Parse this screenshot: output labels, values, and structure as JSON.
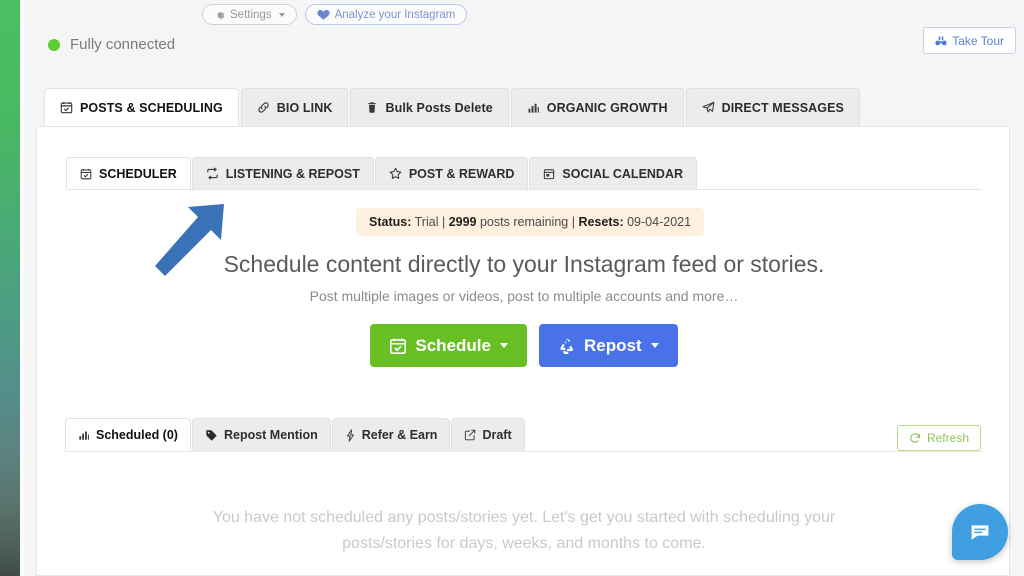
{
  "topbar": {
    "settings_label": "Settings",
    "settings_icon": "gear-icon",
    "analyze_label": "Analyze your Instagram",
    "analyze_icon": "heart-badge-icon",
    "connection_status": "Fully connected",
    "connection_dot_color": "#5ccc33",
    "take_tour_label": "Take Tour",
    "take_tour_icon": "binoculars-icon"
  },
  "main_tabs": [
    {
      "label": "POSTS & SCHEDULING",
      "icon": "calendar-check-icon",
      "active": true
    },
    {
      "label": "BIO LINK",
      "icon": "link-icon",
      "active": false
    },
    {
      "label": "Bulk Posts Delete",
      "icon": "trash-icon",
      "active": false
    },
    {
      "label": "ORGANIC GROWTH",
      "icon": "bar-chart-icon",
      "active": false
    },
    {
      "label": "DIRECT MESSAGES",
      "icon": "paper-plane-icon",
      "active": false
    }
  ],
  "sub_tabs": [
    {
      "label": "SCHEDULER",
      "icon": "calendar-check-icon",
      "active": true
    },
    {
      "label": "LISTENING & REPOST",
      "icon": "repeat-icon",
      "active": false
    },
    {
      "label": "POST & REWARD",
      "icon": "star-icon",
      "active": false
    },
    {
      "label": "SOCIAL CALENDAR",
      "icon": "calendar-icon",
      "active": false
    }
  ],
  "status_banner": {
    "status_label": "Status:",
    "status_value": "Trial",
    "sep1": "|",
    "posts_count": "2999",
    "posts_text": "posts remaining",
    "sep2": "|",
    "resets_label": "Resets:",
    "resets_value": "09-04-2021",
    "background": "#fdf0df"
  },
  "hero": {
    "title": "Schedule content directly to your Instagram feed or stories.",
    "subtitle": "Post multiple images or videos, post to multiple accounts and more…",
    "schedule_button": {
      "label": "Schedule",
      "icon": "calendar-check-icon",
      "color": "#68c025"
    },
    "repost_button": {
      "label": "Repost",
      "icon": "recycle-icon",
      "color": "#4a72e8"
    }
  },
  "lower_tabs": [
    {
      "label": "Scheduled (0)",
      "icon": "bar-chart-icon",
      "active": true
    },
    {
      "label": "Repost Mention",
      "icon": "tag-icon",
      "active": false
    },
    {
      "label": "Refer & Earn",
      "icon": "bolt-icon",
      "active": false
    },
    {
      "label": "Draft",
      "icon": "edit-square-icon",
      "active": false
    }
  ],
  "refresh_button": {
    "label": "Refresh",
    "icon": "refresh-icon",
    "color": "#91c45b"
  },
  "empty_state": {
    "line1": "You have not scheduled any posts/stories yet. Let's get you started with scheduling your",
    "line2": "posts/stories for days, weeks, and months to come."
  },
  "annotation": {
    "arrow": "blue-arrow-up-right",
    "color": "#3a72b8"
  },
  "chat_widget": {
    "icon": "chat-bubble-icon",
    "color": "#3f9fe0"
  }
}
